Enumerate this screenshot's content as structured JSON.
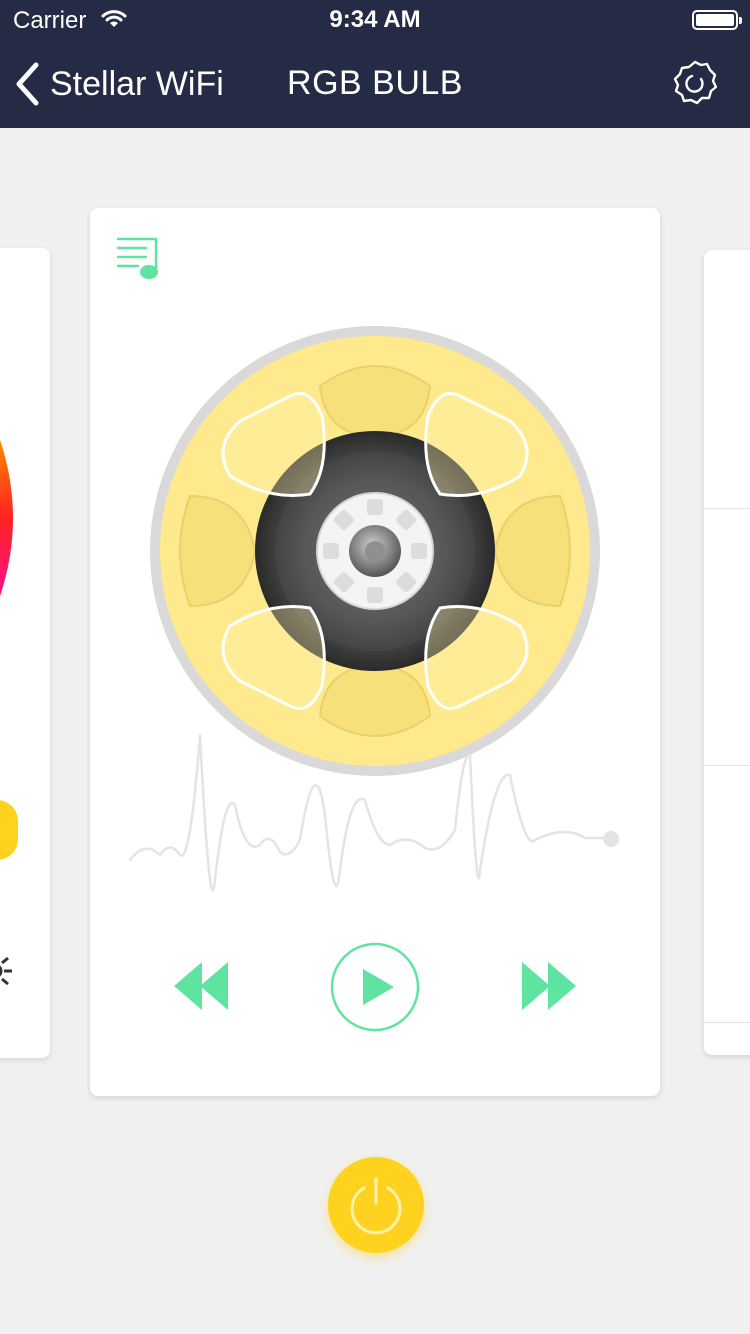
{
  "status_bar": {
    "carrier": "Carrier",
    "time": "9:34 AM",
    "battery_level": 1.0
  },
  "nav": {
    "back_label": "Stellar WiFi",
    "title": "RGB BULB",
    "back_icon": "chevron-left-icon",
    "settings_icon": "gear-icon"
  },
  "player": {
    "playlist_icon": "playlist-music-icon",
    "disc_icon": "reel-disc-icon",
    "controls": [
      "rewind-icon",
      "play-icon",
      "fast-forward-icon"
    ]
  },
  "power_icon": "power-icon",
  "colors": {
    "nav_bg": "#252a45",
    "accent_green": "#5ee4a0",
    "power_yellow": "#ffd21f",
    "disc_yellow": "#feea8c"
  }
}
